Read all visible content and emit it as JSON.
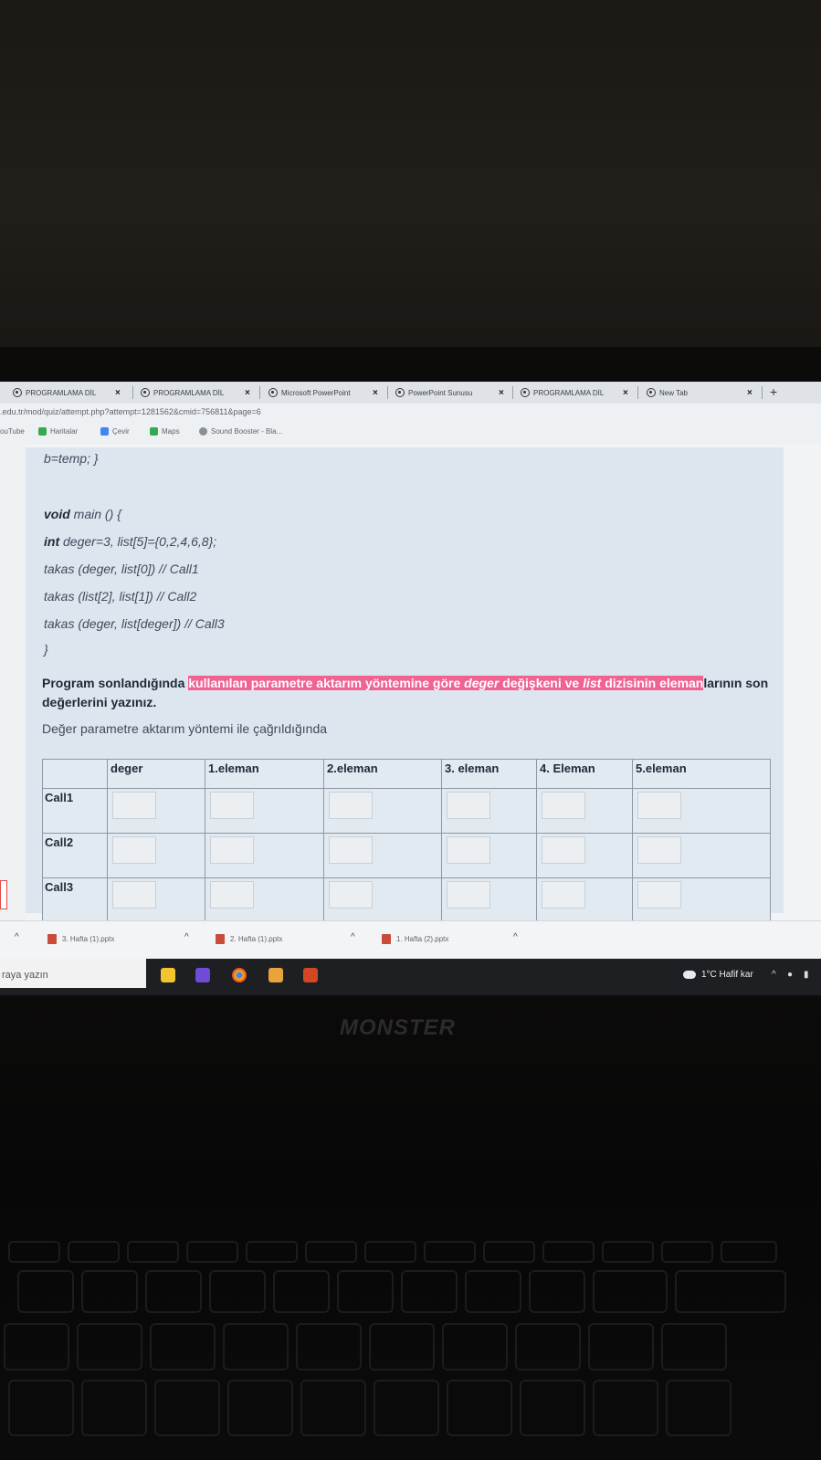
{
  "browser": {
    "tabs": [
      {
        "label": "PROGRAMLAMA DİL"
      },
      {
        "label": "PROGRAMLAMA DİL"
      },
      {
        "label": "Microsoft PowerPoint"
      },
      {
        "label": "PowerPoint Sunusu"
      },
      {
        "label": "PROGRAMLAMA DİL"
      },
      {
        "label": "New Tab"
      }
    ],
    "new_tab_symbol": "+",
    "close_symbol": "×",
    "url": ".edu.tr/mod/quiz/attempt.php?attempt=1281562&cmid=756811&page=6",
    "bookmarks": [
      {
        "label": "ouTube"
      },
      {
        "label": "Haritalar"
      },
      {
        "label": "Çevir"
      },
      {
        "label": "Maps"
      },
      {
        "label": "Sound Booster - Bla..."
      }
    ]
  },
  "quiz": {
    "code_lines": {
      "line1": "b=temp; }",
      "line2_kw": "void",
      "line2_rest": " main () {",
      "line3_kw": "int",
      "line3_rest": " deger=3, list[5]={0,2,4,6,8};",
      "line4": "takas (deger, list[0]) // Call1",
      "line5": "takas (list[2], list[1]) // Call2",
      "line6": "takas (deger, list[deger]) // Call3",
      "line7": "}"
    },
    "prompt": {
      "part1": "Program sonlandığında ",
      "hl1": "kullanılan parametre aktarım yöntemine göre ",
      "hl_deger": "deger",
      "hl2": " değişkeni ve ",
      "hl_list": "list",
      "hl3": " dizisinin eleman",
      "part2": "larının son değerlerini yazınız."
    },
    "subtext": "Değer parametre aktarım yöntemi ile çağrıldığında",
    "table": {
      "headers": [
        "",
        "deger",
        "1.eleman",
        "2.eleman",
        "3. eleman",
        "4. Eleman",
        "5.eleman"
      ],
      "rows": [
        "Call1",
        "Call2",
        "Call3"
      ]
    }
  },
  "downloads": [
    {
      "label": "3. Hafta (1).pptx"
    },
    {
      "label": "2. Hafta (1).pptx"
    },
    {
      "label": "1. Hafta (2).pptx"
    }
  ],
  "taskbar": {
    "search_placeholder": "raya yazın",
    "weather": "1°C  Hafif kar"
  },
  "laptop": {
    "brand": "MONSTER"
  },
  "colors": {
    "highlight": "#f06292",
    "question_bg": "#dde6ee",
    "taskbar_bg": "#1d1f23"
  }
}
